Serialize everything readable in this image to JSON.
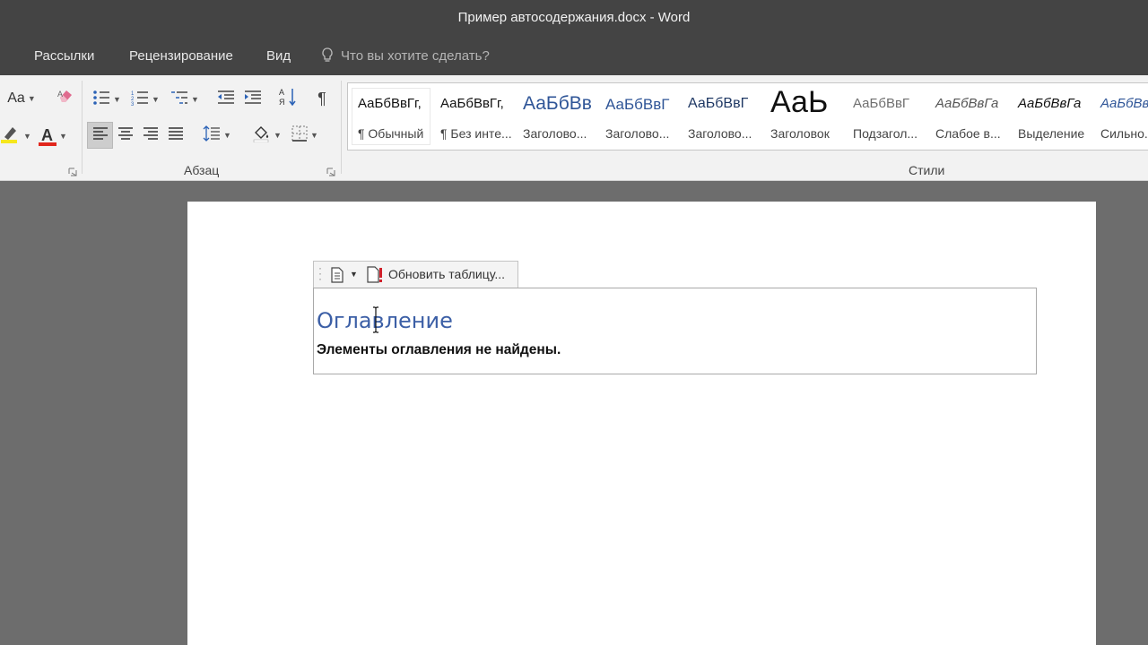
{
  "window": {
    "title": "Пример автосодержания.docx  -  Word"
  },
  "tabs": [
    {
      "label": "Рассылки"
    },
    {
      "label": "Рецензирование"
    },
    {
      "label": "Вид"
    }
  ],
  "tell_me": {
    "placeholder": "Что вы хотите сделать?",
    "icon": "lightbulb-icon"
  },
  "ribbon": {
    "font_group": {
      "font_size_label": "Aa",
      "highlight_label": "aby",
      "font_color_label": "A"
    },
    "paragraph_group": {
      "label": "Абзац"
    },
    "styles_group": {
      "label": "Стили"
    },
    "styles": [
      {
        "sample": "АаБбВвГг,",
        "name": "¶ Обычный"
      },
      {
        "sample": "АаБбВвГг,",
        "name": "¶ Без инте..."
      },
      {
        "sample": "АаБбВв",
        "name": "Заголово..."
      },
      {
        "sample": "АаБбВвГ",
        "name": "Заголово..."
      },
      {
        "sample": "АаБбВвГ",
        "name": "Заголово..."
      },
      {
        "sample": "АаЬ",
        "name": "Заголовок"
      },
      {
        "sample": "АаБбВвГ",
        "name": "Подзагол..."
      },
      {
        "sample": "АаБбВвГа",
        "name": "Слабое в..."
      },
      {
        "sample": "АаБбВвГа",
        "name": "Выделение"
      },
      {
        "sample": "АаБбВвГа",
        "name": "Сильно..."
      }
    ]
  },
  "toc": {
    "update_button_label": "Обновить таблицу...",
    "heading": "Оглавление",
    "empty_message": "Элементы оглавления не найдены."
  },
  "colors": {
    "titlebar": "#444444",
    "ribbon": "#f2f2f2",
    "workspace": "#6d6d6d",
    "heading_blue": "#3c5fa6",
    "font_color_red": "#e2261c",
    "highlight_yellow": "#f6e71d"
  }
}
